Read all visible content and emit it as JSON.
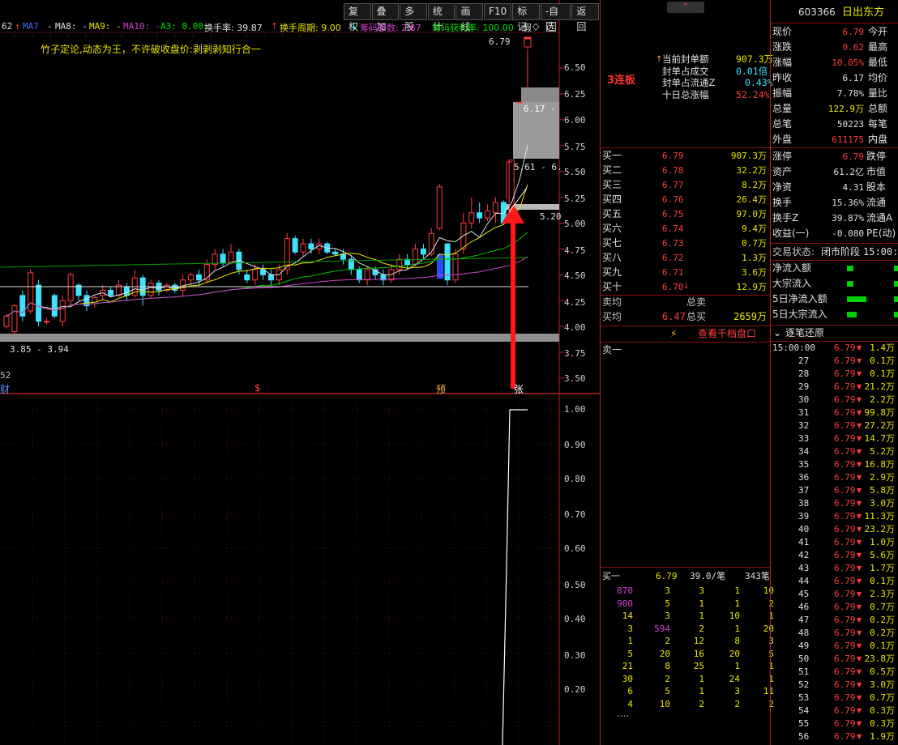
{
  "toolbar": {
    "items": [
      "复权",
      "叠加",
      "多股",
      "统计",
      "画线",
      "F10",
      "标记",
      "-自选",
      "返回"
    ]
  },
  "indicators": {
    "ma62": "62",
    "ma7": "MA7",
    "ma7v": "-",
    "ma8": "MA8: -",
    "ma9": "MA9: -",
    "ma10": "MA10: -",
    "a3": "A3: 0.00",
    "hsl": "换手率: 39.87",
    "hszq": "换手周期: 9.00",
    "cmcs": "筹码参数: 2.67",
    "cmhl": "筹码获利率: 100.00",
    "jia": "假"
  },
  "slogan": "竹子定论,动态为王，不许破收盘价:剥剥剥知行合一",
  "price_labels": {
    "top": "6.79",
    "zt": "6.17 -",
    "mid1": "5.61 - 6.",
    "mid2": "5.20",
    "low": "3.85 - 3.94",
    "lvl": "52"
  },
  "markers": {
    "cai": "财",
    "s": "$",
    "yu": "预",
    "zhang": "张"
  },
  "y_main": [
    "6.50",
    "6.25",
    "6.00",
    "5.75",
    "5.50",
    "5.25",
    "5.00",
    "4.75",
    "4.50",
    "4.25",
    "4.00",
    "3.75",
    "3.50"
  ],
  "y_sub": [
    "1.00",
    "0.90",
    "0.80",
    "0.70",
    "0.60",
    "0.50",
    "0.40",
    "0.30",
    "0.20"
  ],
  "panel": {
    "lianban": "3连板",
    "fengdan": [
      [
        "当前封单额",
        "907.3万"
      ],
      [
        "封单占成交",
        "0.01倍"
      ],
      [
        "封单占流通Z",
        "0.43%"
      ],
      [
        "十日总涨幅",
        "52.24%"
      ]
    ],
    "buys": [
      [
        "买一",
        "6.79",
        "907.3万"
      ],
      [
        "买二",
        "6.78",
        "32.2万"
      ],
      [
        "买三",
        "6.77",
        "8.2万"
      ],
      [
        "买四",
        "6.76",
        "26.4万"
      ],
      [
        "买五",
        "6.75",
        "97.0万"
      ],
      [
        "买六",
        "6.74",
        "9.4万"
      ],
      [
        "买七",
        "6.73",
        "0.7万"
      ],
      [
        "买八",
        "6.72",
        "1.3万"
      ],
      [
        "买九",
        "6.71",
        "3.6万"
      ],
      [
        "买十",
        "6.70",
        "12.9万"
      ]
    ],
    "sell_avg_label": "卖均",
    "sell_total_label": "总卖",
    "buy_avg_label": "买均",
    "buy_avg": "6.47",
    "buy_total_label": "总买",
    "buy_total": "2659万",
    "qiandang": "查看千档盘口",
    "sell1": "卖一",
    "queue_head": [
      "买一",
      "6.79",
      "39.0/笔",
      "343笔"
    ],
    "queue": [
      [
        "870",
        "3",
        "3",
        "1",
        "10"
      ],
      [
        "900",
        "5",
        "1",
        "1",
        "2"
      ],
      [
        "14",
        "3",
        "1",
        "10",
        "1"
      ],
      [
        "3",
        "594",
        "2",
        "1",
        "20"
      ],
      [
        "1",
        "2",
        "12",
        "8",
        "3"
      ],
      [
        "5",
        "20",
        "16",
        "20",
        "5"
      ],
      [
        "21",
        "8",
        "25",
        "1",
        "1"
      ],
      [
        "30",
        "2",
        "1",
        "24",
        "1"
      ],
      [
        "6",
        "5",
        "1",
        "3",
        "11"
      ],
      [
        "4",
        "10",
        "2",
        "2",
        "2"
      ]
    ],
    "dots": "...."
  },
  "right": {
    "code": "603366",
    "name": "日出东方",
    "quote": [
      [
        "现价",
        "6.79",
        "今开",
        ""
      ],
      [
        "涨跌",
        "0.62",
        "最高",
        ""
      ],
      [
        "涨幅",
        "10.05%",
        "最低",
        ""
      ],
      [
        "昨收",
        "6.17",
        "均价",
        ""
      ],
      [
        "振幅",
        "7.78%",
        "量比",
        ""
      ],
      [
        "总量",
        "122.9万",
        "总额",
        ""
      ],
      [
        "总笔",
        "50223",
        "每笔",
        ""
      ],
      [
        "外盘",
        "611175",
        "内盘",
        ""
      ]
    ],
    "quote2": [
      [
        "涨停",
        "6.79",
        "跌停"
      ],
      [
        "资产",
        "61.2亿",
        "市值"
      ],
      [
        "净资",
        "4.31",
        "股本"
      ],
      [
        "换手",
        "15.36%",
        "流通"
      ],
      [
        "换手Z",
        "39.87%",
        "流通A"
      ],
      [
        "收益(一)",
        "-0.080",
        "PE(动)"
      ]
    ],
    "status_label": "交易状态:",
    "status": "闭市阶段",
    "status_time": "15:00:0",
    "flows": [
      "净流入额",
      "大宗流入",
      "5日净流入额",
      "5日大宗流入"
    ],
    "ticks_title": "逐笔还原",
    "ticks": [
      [
        "15:00:00",
        "6.79",
        "1.4万"
      ],
      [
        "27",
        "6.79",
        "0.1万"
      ],
      [
        "28",
        "6.79",
        "0.1万"
      ],
      [
        "29",
        "6.79",
        "21.2万"
      ],
      [
        "30",
        "6.79",
        "2.2万"
      ],
      [
        "31",
        "6.79",
        "99.8万"
      ],
      [
        "32",
        "6.79",
        "27.2万"
      ],
      [
        "33",
        "6.79",
        "14.7万"
      ],
      [
        "34",
        "6.79",
        "5.2万"
      ],
      [
        "35",
        "6.79",
        "16.8万"
      ],
      [
        "36",
        "6.79",
        "2.9万"
      ],
      [
        "37",
        "6.79",
        "5.8万"
      ],
      [
        "38",
        "6.79",
        "3.0万"
      ],
      [
        "39",
        "6.79",
        "11.3万"
      ],
      [
        "40",
        "6.79",
        "23.2万"
      ],
      [
        "41",
        "6.79",
        "1.0万"
      ],
      [
        "42",
        "6.79",
        "5.6万"
      ],
      [
        "43",
        "6.79",
        "1.7万"
      ],
      [
        "44",
        "6.79",
        "0.1万"
      ],
      [
        "45",
        "6.79",
        "2.3万"
      ],
      [
        "46",
        "6.79",
        "0.7万"
      ],
      [
        "47",
        "6.79",
        "0.2万"
      ],
      [
        "48",
        "6.79",
        "0.2万"
      ],
      [
        "49",
        "6.79",
        "0.1万"
      ],
      [
        "50",
        "6.79",
        "23.8万"
      ],
      [
        "51",
        "6.79",
        "0.5万"
      ],
      [
        "52",
        "6.79",
        "3.0万"
      ],
      [
        "53",
        "6.79",
        "0.7万"
      ],
      [
        "54",
        "6.79",
        "0.3万"
      ],
      [
        "55",
        "6.79",
        "0.3万"
      ],
      [
        "56",
        "6.79",
        "1.9万"
      ]
    ]
  },
  "colors": {
    "up": "#ff3c3c",
    "down": "#40e0ff",
    "ma_white": "#e0e0e0",
    "ma_yellow": "#e8e800",
    "ma_magenta": "#d040d0",
    "ma_green": "#00c000",
    "frame": "#b22222"
  },
  "chart_data": {
    "type": "candlestick",
    "y_range": [
      3.35,
      6.95
    ],
    "candles": [
      [
        4.0,
        4.1,
        3.98,
        4.12
      ],
      [
        3.95,
        4.2,
        3.92,
        4.22
      ],
      [
        4.3,
        4.1,
        4.05,
        4.35
      ],
      [
        4.15,
        4.52,
        4.12,
        4.55
      ],
      [
        4.4,
        4.05,
        4.0,
        4.45
      ],
      [
        4.05,
        4.05,
        4.02,
        4.08
      ],
      [
        4.3,
        4.1,
        4.08,
        4.32
      ],
      [
        4.05,
        4.25,
        4.0,
        4.3
      ],
      [
        4.25,
        4.5,
        4.2,
        4.52
      ],
      [
        4.4,
        4.3,
        4.25,
        4.42
      ],
      [
        4.3,
        4.2,
        4.15,
        4.35
      ],
      [
        4.22,
        4.28,
        4.18,
        4.3
      ],
      [
        4.3,
        4.35,
        4.25,
        4.4
      ],
      [
        4.35,
        4.3,
        4.28,
        4.38
      ],
      [
        4.3,
        4.4,
        4.28,
        4.45
      ],
      [
        4.38,
        4.3,
        4.25,
        4.42
      ],
      [
        4.3,
        4.47,
        4.28,
        4.55
      ],
      [
        4.47,
        4.3,
        4.2,
        4.5
      ],
      [
        4.3,
        4.42,
        4.28,
        4.45
      ],
      [
        4.42,
        4.35,
        4.3,
        4.45
      ],
      [
        4.35,
        4.4,
        4.33,
        4.42
      ],
      [
        4.4,
        4.35,
        4.32,
        4.42
      ],
      [
        4.35,
        4.45,
        4.3,
        4.5
      ],
      [
        4.45,
        4.5,
        4.4,
        4.52
      ],
      [
        4.5,
        4.45,
        4.4,
        4.55
      ],
      [
        4.45,
        4.6,
        4.42,
        4.65
      ],
      [
        4.6,
        4.7,
        4.55,
        4.75
      ],
      [
        4.7,
        4.62,
        4.58,
        4.75
      ],
      [
        4.62,
        4.72,
        4.6,
        4.8
      ],
      [
        4.72,
        4.55,
        4.5,
        4.75
      ],
      [
        4.5,
        4.45,
        4.42,
        4.55
      ],
      [
        4.45,
        4.55,
        4.4,
        4.6
      ],
      [
        4.55,
        4.5,
        4.45,
        4.6
      ],
      [
        4.5,
        4.45,
        4.4,
        4.55
      ],
      [
        4.45,
        4.55,
        4.4,
        4.6
      ],
      [
        4.55,
        4.85,
        4.5,
        4.9
      ],
      [
        4.85,
        4.72,
        4.7,
        4.88
      ],
      [
        4.72,
        4.8,
        4.68,
        4.85
      ],
      [
        4.8,
        4.75,
        4.7,
        4.85
      ],
      [
        4.75,
        4.8,
        4.7,
        4.85
      ],
      [
        4.8,
        4.72,
        4.7,
        4.82
      ],
      [
        4.72,
        4.7,
        4.68,
        4.75
      ],
      [
        4.7,
        4.65,
        4.6,
        4.75
      ],
      [
        4.65,
        4.55,
        4.5,
        4.68
      ],
      [
        4.55,
        4.45,
        4.42,
        4.58
      ],
      [
        4.45,
        4.55,
        4.4,
        4.58
      ],
      [
        4.55,
        4.5,
        4.45,
        4.58
      ],
      [
        4.5,
        4.45,
        4.4,
        4.55
      ],
      [
        4.45,
        4.55,
        4.42,
        4.6
      ],
      [
        4.55,
        4.65,
        4.5,
        4.7
      ],
      [
        4.65,
        4.6,
        4.55,
        4.7
      ],
      [
        4.6,
        4.75,
        4.58,
        4.8
      ],
      [
        4.75,
        4.7,
        4.65,
        4.8
      ],
      [
        4.7,
        4.9,
        4.68,
        4.95
      ],
      [
        4.95,
        5.35,
        4.93,
        5.38
      ],
      [
        4.8,
        4.45,
        4.4,
        4.8
      ],
      [
        4.45,
        4.7,
        4.42,
        4.75
      ],
      [
        4.75,
        5.0,
        4.7,
        5.1
      ],
      [
        5.0,
        5.1,
        4.95,
        5.25
      ],
      [
        5.1,
        5.05,
        5.0,
        5.2
      ],
      [
        5.05,
        5.12,
        5.02,
        5.18
      ],
      [
        5.1,
        5.2,
        5.0,
        5.25
      ],
      [
        5.2,
        5.0,
        4.98,
        5.22
      ],
      [
        5.0,
        5.61,
        4.98,
        5.61
      ],
      [
        6.17,
        6.17,
        6.17,
        6.17
      ],
      [
        6.79,
        6.79,
        6.79,
        6.79
      ]
    ]
  }
}
